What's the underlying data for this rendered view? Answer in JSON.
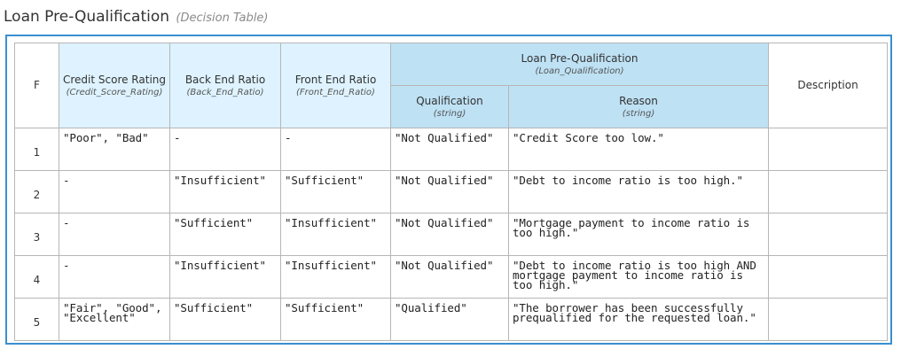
{
  "title": {
    "name": "Loan Pre-Qualification",
    "subtitle": "(Decision Table)"
  },
  "table": {
    "hit_policy": "F",
    "inputs": [
      {
        "label": "Credit Score Rating",
        "type": "(Credit_Score_Rating)"
      },
      {
        "label": "Back End Ratio",
        "type": "(Back_End_Ratio)"
      },
      {
        "label": "Front End Ratio",
        "type": "(Front_End_Ratio)"
      }
    ],
    "output_group": {
      "label": "Loan Pre-Qualification",
      "type": "(Loan_Qualification)",
      "columns": [
        {
          "label": "Qualification",
          "type": "(string)"
        },
        {
          "label": "Reason",
          "type": "(string)"
        }
      ]
    },
    "annotation_header": "Description",
    "rows": [
      {
        "num": "1",
        "cells": [
          "\"Poor\", \"Bad\"",
          "-",
          "-",
          "\"Not Qualified\"",
          "\"Credit Score too low.\"",
          ""
        ]
      },
      {
        "num": "2",
        "cells": [
          "-",
          "\"Insufficient\"",
          "\"Sufficient\"",
          "\"Not Qualified\"",
          "\"Debt to income ratio is too high.\"",
          ""
        ]
      },
      {
        "num": "3",
        "cells": [
          "-",
          "\"Sufficient\"",
          "\"Insufficient\"",
          "\"Not Qualified\"",
          "\"Mortgage payment to income ratio is too high.\"",
          ""
        ]
      },
      {
        "num": "4",
        "cells": [
          "-",
          "\"Insufficient\"",
          "\"Insufficient\"",
          "\"Not Qualified\"",
          "\"Debt to income ratio is too high AND mortgage payment to income ratio is too high.\"",
          ""
        ]
      },
      {
        "num": "5",
        "cells": [
          "\"Fair\", \"Good\", \"Excellent\"",
          "\"Sufficient\"",
          "\"Sufficient\"",
          "\"Qualified\"",
          "\"The borrower has been successfully prequalified for the requested loan.\"",
          ""
        ]
      }
    ]
  }
}
